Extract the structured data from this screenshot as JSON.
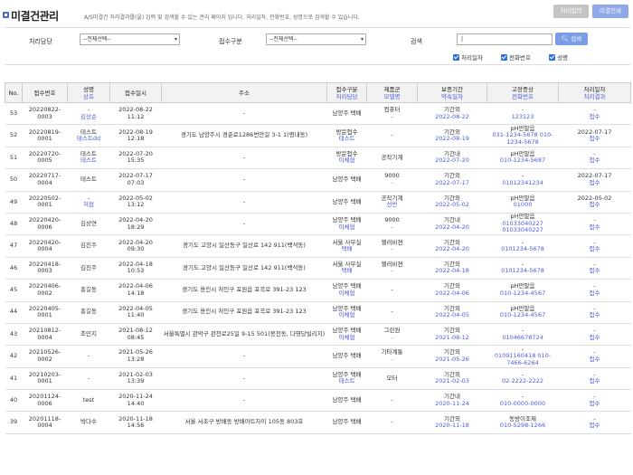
{
  "header": {
    "title": "미결건관리",
    "description": "A/S미결건 처리결과를(을) 입력 및 검색할 수 있는 관리 페이지 입니다. 처리일자, 전화번호, 성명으로 검색할 수 있습니다.",
    "btn_process_input": "처리입력",
    "btn_print": "미결인쇄"
  },
  "search": {
    "label_manager": "처리담당",
    "manager_value": "--전체선택--",
    "label_category": "접수구분",
    "category_value": "--전체선택--",
    "label_search": "검색",
    "search_value": "|",
    "search_button": "검색",
    "cb_date": "처리일자",
    "cb_phone": "전화번호",
    "cb_name": "성명"
  },
  "table": {
    "headers": {
      "no": "No.",
      "receipt_no": "접수번호",
      "name": "성명",
      "name_sub": "상호",
      "date": "접수일시",
      "address": "주소",
      "category": "접수구분",
      "category_sub": "처리담당",
      "product": "제품군",
      "product_sub": "모델명",
      "warranty": "보증기간",
      "warranty_sub": "약속일자",
      "symptom": "고장증상",
      "symptom_sub": "전화번호",
      "processed": "처리일자",
      "processed_sub": "처리결과"
    },
    "rows": [
      {
        "no": "53",
        "rn": "20220822-0003",
        "n1": "-",
        "n2": "김상순",
        "d1": "2022-08-22",
        "d2": "11:12",
        "addr": "-",
        "c1": "남양주 택배",
        "c2": "",
        "p1": "컴퓨터",
        "p2": "-",
        "w1": "기간외",
        "w2": "2022-08-22",
        "s1": "-",
        "s2": "123123",
        "r1": "-",
        "r2": "접수"
      },
      {
        "no": "52",
        "rn": "20220819-0001",
        "n1": "테스트",
        "n2": "테스트dd",
        "d1": "2022-08-19",
        "d2": "12:18",
        "addr": "경기도 남양주시 경춘로1286번안길 3-1 1(평내동)",
        "c1": "방문접수",
        "c2": "테스트",
        "p1": "-",
        "p2": "",
        "w1": "기간외",
        "w2": "2022-08-19",
        "s1": "pH만말음",
        "s2": "031-1234-5678 010-1234-5678",
        "r1": "2022-07-17",
        "r2": "접수"
      },
      {
        "no": "51",
        "rn": "20220720-0005",
        "n1": "테스트",
        "n2": "테스트",
        "d1": "2022-07-20",
        "d2": "15:35",
        "addr": "-",
        "c1": "방문접수",
        "c2": "이체협",
        "p1": "공작기계",
        "p2": "",
        "w1": "기간내",
        "w2": "2022-07-20",
        "s1": "pH만말음",
        "s2": "010-1234-5687",
        "r1": "-",
        "r2": "접수"
      },
      {
        "no": "50",
        "rn": "20220717-0004",
        "n1": "테스트",
        "n2": "",
        "d1": "2022-07-17",
        "d2": "07:03",
        "addr": "-",
        "c1": "남양주 택배",
        "c2": "",
        "p1": "9000",
        "p2": "-",
        "w1": "기간외",
        "w2": "2022-07-17",
        "s1": "-",
        "s2": "01012341234",
        "r1": "2022-07-17",
        "r2": "접수"
      },
      {
        "no": "49",
        "rn": "20220502-0001",
        "n1": "-",
        "n2": "처협",
        "d1": "2022-05-02",
        "d2": "13:12",
        "addr": "-",
        "c1": "남양주 택배",
        "c2": "",
        "p1": "공작기계",
        "p2": "선반",
        "w1": "기간외",
        "w2": "2022-05-02",
        "s1": "pH만말음",
        "s2": "01000",
        "r1": "2022-05-02",
        "r2": "접수"
      },
      {
        "no": "48",
        "rn": "20220420-0006",
        "n1": "김상연",
        "n2": "",
        "d1": "2022-04-20",
        "d2": "18:29",
        "addr": "-",
        "c1": "남양주 택배",
        "c2": "이체협",
        "p1": "9000",
        "p2": "-",
        "w1": "기간내",
        "w2": "2022-04-20",
        "s1": "pH만말음",
        "s2": "01033040227 01033040227",
        "r1": "-",
        "r2": "접수"
      },
      {
        "no": "47",
        "rn": "20220420-0004",
        "n1": "김진주",
        "n2": "",
        "d1": "2022-04-20",
        "d2": "09:30",
        "addr": "경기도 고양시 일산동구 일산로 142 911(백석동)",
        "c1": "서울 사무실",
        "c2": "택배",
        "p1": "헬러비젼",
        "p2": "-",
        "w1": "기간외",
        "w2": "2022-04-20",
        "s1": "-",
        "s2": "0101234-5678",
        "r1": "-",
        "r2": "접수"
      },
      {
        "no": "46",
        "rn": "20220418-0003",
        "n1": "김진주",
        "n2": "",
        "d1": "2022-04-18",
        "d2": "10:53",
        "addr": "경기도 고양시 일산동구 일산로 142 911(백석동)",
        "c1": "서울 사무실",
        "c2": "택배",
        "p1": "헬러비젼",
        "p2": "-",
        "w1": "기간외",
        "w2": "2022-04-18",
        "s1": "-",
        "s2": "0101234-5678",
        "r1": "-",
        "r2": "접수"
      },
      {
        "no": "45",
        "rn": "20220406-0002",
        "n1": "홍길동",
        "n2": "",
        "d1": "2022-04-06",
        "d2": "14:18",
        "addr": "경기도 용인시 처인구 포원읍 포곡로 391-23 123",
        "c1": "남양주 택배",
        "c2": "이체협",
        "p1": "-",
        "p2": "",
        "w1": "기간외",
        "w2": "2022-04-06",
        "s1": "pH만말음",
        "s2": "010-1234-4567",
        "r1": "-",
        "r2": "접수"
      },
      {
        "no": "44",
        "rn": "20220405-0001",
        "n1": "홍길동",
        "n2": "",
        "d1": "2022-04-05",
        "d2": "11:40",
        "addr": "경기도 용인시 처인구 포원읍 포곡로 391-23 123",
        "c1": "남양주 택배",
        "c2": "이체협",
        "p1": "-",
        "p2": "",
        "w1": "기간외",
        "w2": "2022-04-05",
        "s1": "pH만말음",
        "s2": "010-1234-4567",
        "r1": "-",
        "r2": "접수"
      },
      {
        "no": "43",
        "rn": "20210812-0004",
        "n1": "조민지",
        "n2": "",
        "d1": "2021-08-12",
        "d2": "08:45",
        "addr": "서울특별시 관악구 관천로25일 9-15 501(봉천동, 다영당빌리지)",
        "c1": "남양주 택배",
        "c2": "이체협",
        "p1": "그린원",
        "p2": "-",
        "w1": "기간외",
        "w2": "2021-08-12",
        "s1": "-",
        "s2": "01046678724",
        "r1": "-",
        "r2": "접수"
      },
      {
        "no": "42",
        "rn": "20210526-0002",
        "n1": "-",
        "n2": "",
        "d1": "2021-05-26",
        "d2": "13:28",
        "addr": "-",
        "c1": "남양주 택배",
        "c2": "",
        "p1": "기타계통",
        "p2": "-",
        "w1": "기간외",
        "w2": "2021-05-26",
        "s1": "-",
        "s2": "01091160418 010-7466-6264",
        "r1": "-",
        "r2": "접수"
      },
      {
        "no": "41",
        "rn": "20210203-0001",
        "n1": "-",
        "n2": "",
        "d1": "2021-02-03",
        "d2": "13:39",
        "addr": "-",
        "c1": "남양주 택배",
        "c2": "테스트",
        "p1": "모터",
        "p2": "",
        "w1": "기간외",
        "w2": "2021-02-03",
        "s1": "-",
        "s2": "02-2222-2222",
        "r1": "-",
        "r2": "접수"
      },
      {
        "no": "40",
        "rn": "20201124-0006",
        "n1": "test",
        "n2": "",
        "d1": "2020-11-24",
        "d2": "14:40",
        "addr": "-",
        "c1": "남양주 택배",
        "c2": "",
        "p1": "-",
        "p2": "",
        "w1": "기간내",
        "w2": "2020-11-24",
        "s1": "-",
        "s2": "010-0000-0000",
        "r1": "-",
        "r2": "접수"
      },
      {
        "no": "39",
        "rn": "20201118-0004",
        "n1": "박다수",
        "n2": "",
        "d1": "2020-11-18",
        "d2": "14:56",
        "addr": "서울 서초구 방배동 방배아트자이 105동 803호",
        "c1": "남양주 택배",
        "c2": "",
        "p1": "-",
        "p2": "",
        "w1": "기간외",
        "w2": "2020-11-18",
        "s1": "동방이조제",
        "s2": "010-5298-1266",
        "r1": "-",
        "r2": "접수"
      }
    ]
  },
  "colors": {
    "accent": "#4a5ce0",
    "button_blue": "#7a9de6",
    "checkbox": "#2f6fe0"
  }
}
